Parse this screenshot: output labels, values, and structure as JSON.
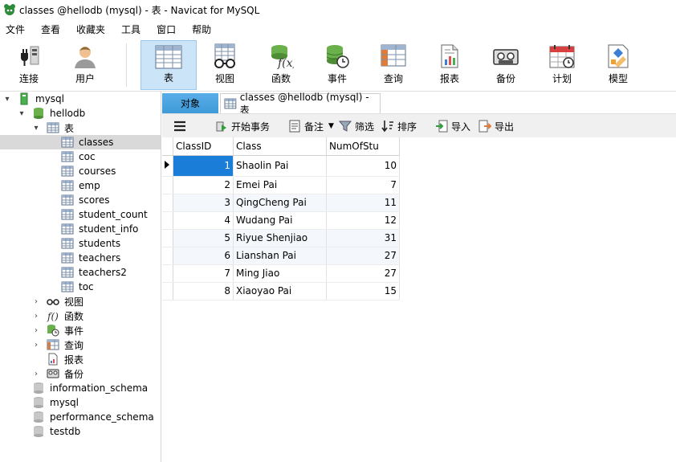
{
  "window": {
    "title": "classes @hellodb (mysql) - 表 - Navicat for MySQL"
  },
  "menu": [
    "文件",
    "查看",
    "收藏夹",
    "工具",
    "窗口",
    "帮助"
  ],
  "toolbar": {
    "buttons": [
      {
        "label": "连接",
        "icon": "plug-icon"
      },
      {
        "label": "用户",
        "icon": "user-icon"
      },
      {
        "label": "表",
        "icon": "table-icon",
        "active": true
      },
      {
        "label": "视图",
        "icon": "glasses-icon"
      },
      {
        "label": "函数",
        "icon": "function-icon"
      },
      {
        "label": "事件",
        "icon": "event-clock-icon"
      },
      {
        "label": "查询",
        "icon": "query-icon"
      },
      {
        "label": "报表",
        "icon": "report-icon"
      },
      {
        "label": "备份",
        "icon": "backup-tape-icon"
      },
      {
        "label": "计划",
        "icon": "calendar-icon"
      },
      {
        "label": "模型",
        "icon": "model-icon"
      }
    ]
  },
  "tree": {
    "connection": "mysql",
    "database": "hellodb",
    "tables_folder": "表",
    "tables": [
      "classes",
      "coc",
      "courses",
      "emp",
      "scores",
      "student_count",
      "student_info",
      "students",
      "teachers",
      "teachers2",
      "toc"
    ],
    "selected_table": "classes",
    "folders": [
      {
        "label": "视图",
        "icon": "glasses-icon"
      },
      {
        "label": "函数",
        "icon": "function-icon"
      },
      {
        "label": "事件",
        "icon": "event-clock-icon"
      },
      {
        "label": "查询",
        "icon": "query-icon"
      },
      {
        "label": "报表",
        "icon": "report-icon"
      },
      {
        "label": "备份",
        "icon": "backup-tape-icon"
      }
    ],
    "other_databases": [
      "information_schema",
      "mysql",
      "performance_schema",
      "testdb"
    ]
  },
  "tabs": {
    "objects": "对象",
    "current": "classes @hellodb (mysql) - 表"
  },
  "subtoolbar": {
    "begin_transaction": "开始事务",
    "memo": "备注",
    "filter": "筛选",
    "sort": "排序",
    "import": "导入",
    "export": "导出"
  },
  "grid": {
    "columns": [
      "ClassID",
      "Class",
      "NumOfStu"
    ],
    "rows": [
      [
        "1",
        "Shaolin Pai",
        "10"
      ],
      [
        "2",
        "Emei Pai",
        "7"
      ],
      [
        "3",
        "QingCheng Pai",
        "11"
      ],
      [
        "4",
        "Wudang Pai",
        "12"
      ],
      [
        "5",
        "Riyue Shenjiao",
        "31"
      ],
      [
        "6",
        "Lianshan Pai",
        "27"
      ],
      [
        "7",
        "Ming Jiao",
        "27"
      ],
      [
        "8",
        "Xiaoyao Pai",
        "15"
      ]
    ],
    "selected_row": 0,
    "colors": {
      "selection": "#1a7ed8",
      "alt_row": "#f4f8fc"
    }
  }
}
